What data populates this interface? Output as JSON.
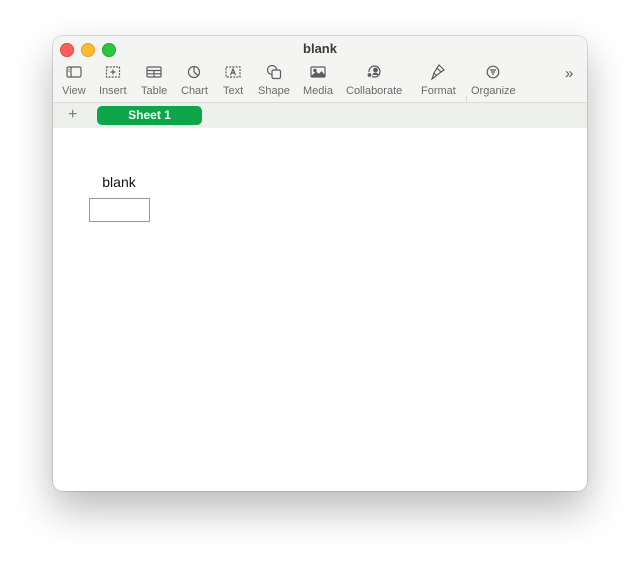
{
  "window": {
    "title": "blank",
    "traffic_lights": [
      "close",
      "minimize",
      "maximize"
    ]
  },
  "toolbar": {
    "items": [
      {
        "label": "View",
        "icon": "sidebar-icon"
      },
      {
        "label": "Insert",
        "icon": "insert-icon"
      },
      {
        "label": "Table",
        "icon": "table-icon"
      },
      {
        "label": "Chart",
        "icon": "chart-icon"
      },
      {
        "label": "Text",
        "icon": "text-box-icon"
      },
      {
        "label": "Shape",
        "icon": "shape-icon"
      },
      {
        "label": "Media",
        "icon": "media-icon"
      },
      {
        "label": "Collaborate",
        "icon": "collaborate-icon"
      },
      {
        "label": "Format",
        "icon": "format-brush-icon"
      },
      {
        "label": "Organize",
        "icon": "organize-icon"
      }
    ],
    "more": "»"
  },
  "sheets": {
    "add_label": "+",
    "tabs": [
      {
        "label": "Sheet 1",
        "active": true
      }
    ],
    "active_color": "#0da54a"
  },
  "canvas": {
    "table": {
      "title": "blank",
      "cells": [
        [
          ""
        ]
      ]
    }
  }
}
